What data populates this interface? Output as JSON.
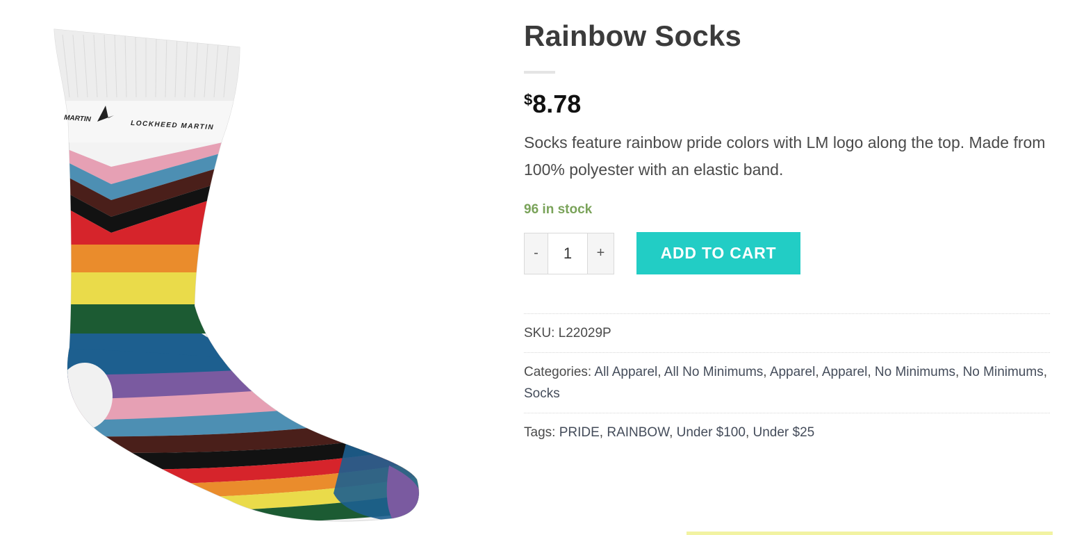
{
  "product": {
    "title": "Rainbow Socks",
    "currency_symbol": "$",
    "price": "8.78",
    "description": "Socks feature rainbow pride colors with LM logo along the top.  Made from 100% polyester with an elastic band.",
    "stock": "96 in stock",
    "image_text_left": "MARTIN",
    "image_text_right": "LOCKHEED MARTIN"
  },
  "cart": {
    "minus_label": "-",
    "plus_label": "+",
    "quantity": "1",
    "add_to_cart_label": "ADD TO CART",
    "accent_color": "#22cdc5"
  },
  "meta": {
    "sku_label": "SKU:",
    "sku": "L22029P",
    "categories_label": "Categories:",
    "categories": [
      "All Apparel",
      "All No Minimums",
      "Apparel",
      "Apparel",
      "No Minimums",
      "No Minimums",
      "Socks"
    ],
    "tags_label": "Tags:",
    "tags": [
      "PRIDE",
      "RAINBOW",
      "Under $100",
      "Under $25"
    ]
  },
  "colors": {
    "stock_green": "#7aa35a",
    "stripes": [
      "#e6a0b4",
      "#4d8fb3",
      "#4a1f1a",
      "#121212",
      "#d6242b",
      "#ea8c2c",
      "#eadb4a",
      "#1c5b33",
      "#1d5f8f",
      "#7a5aa0"
    ]
  }
}
